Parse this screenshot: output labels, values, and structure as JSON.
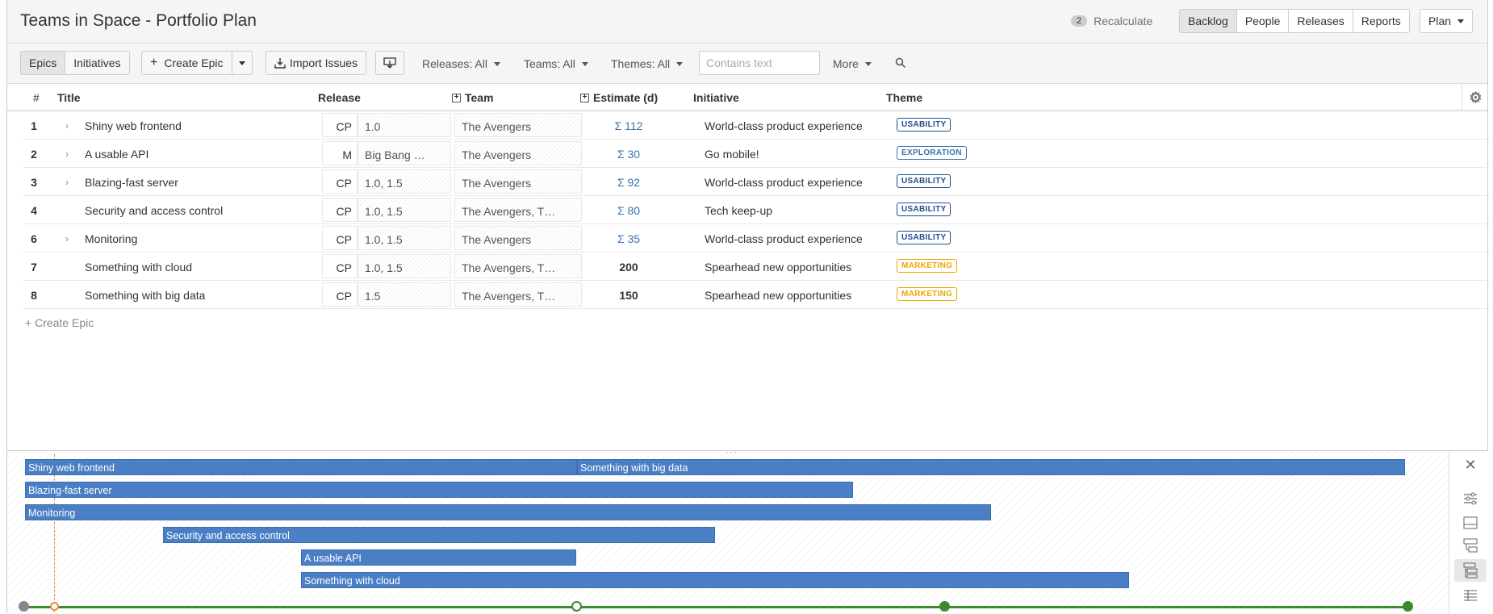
{
  "header": {
    "title": "Teams in Space - Portfolio Plan",
    "recalc_count": "2",
    "recalc_label": "Recalculate",
    "views": [
      "Backlog",
      "People",
      "Releases",
      "Reports"
    ],
    "active_view": "Backlog",
    "plan_label": "Plan"
  },
  "toolbar": {
    "epics_label": "Epics",
    "initiatives_label": "Initiatives",
    "create_epic_label": "Create Epic",
    "import_label": "Import Issues",
    "releases_filter": "Releases: All",
    "teams_filter": "Teams: All",
    "themes_filter": "Themes: All",
    "search_placeholder": "Contains text",
    "more_label": "More"
  },
  "table": {
    "columns": {
      "num": "#",
      "title": "Title",
      "release": "Release",
      "team": "Team",
      "estimate": "Estimate (d)",
      "initiative": "Initiative",
      "theme": "Theme"
    },
    "rows": [
      {
        "num": "1",
        "expandable": true,
        "title": "Shiny web frontend",
        "rel_code": "CP",
        "release": "1.0",
        "team": "The Avengers",
        "estimate": "Σ 112",
        "est_sum": true,
        "initiative": "World-class product experience",
        "theme": "USABILITY"
      },
      {
        "num": "2",
        "expandable": true,
        "title": "A usable API",
        "rel_code": "M",
        "release": "Big Bang …",
        "team": "The Avengers",
        "estimate": "Σ 30",
        "est_sum": true,
        "initiative": "Go mobile!",
        "theme": "EXPLORATION"
      },
      {
        "num": "3",
        "expandable": true,
        "title": "Blazing-fast server",
        "rel_code": "CP",
        "release": "1.0, 1.5",
        "team": "The Avengers",
        "estimate": "Σ 92",
        "est_sum": true,
        "initiative": "World-class product experience",
        "theme": "USABILITY"
      },
      {
        "num": "4",
        "expandable": false,
        "title": "Security and access control",
        "rel_code": "CP",
        "release": "1.0, 1.5",
        "team": "The Avengers, T…",
        "estimate": "Σ 80",
        "est_sum": true,
        "initiative": "Tech keep-up",
        "theme": "USABILITY"
      },
      {
        "num": "6",
        "expandable": true,
        "title": "Monitoring",
        "rel_code": "CP",
        "release": "1.0, 1.5",
        "team": "The Avengers",
        "estimate": "Σ 35",
        "est_sum": true,
        "initiative": "World-class product experience",
        "theme": "USABILITY"
      },
      {
        "num": "7",
        "expandable": false,
        "title": "Something with cloud",
        "rel_code": "CP",
        "release": "1.0, 1.5",
        "team": "The Avengers, T…",
        "estimate": "200",
        "est_sum": false,
        "initiative": "Spearhead new opportunities",
        "theme": "MARKETING"
      },
      {
        "num": "8",
        "expandable": false,
        "title": "Something with big data",
        "rel_code": "CP",
        "release": "1.5",
        "team": "The Avengers, T…",
        "estimate": "150",
        "est_sum": false,
        "initiative": "Spearhead new opportunities",
        "theme": "MARKETING"
      }
    ],
    "create_epic_link": "+ Create Epic"
  },
  "theme_colors": {
    "USABILITY": "#1f4e8c",
    "EXPLORATION": "#3b73af",
    "MARKETING": "#f0a500"
  },
  "timeline": {
    "bars": [
      {
        "label": "Shiny web frontend"
      },
      {
        "label": "Something with big data"
      },
      {
        "label": "Blazing-fast server"
      },
      {
        "label": "Monitoring"
      },
      {
        "label": "Security and access control"
      },
      {
        "label": "A usable API"
      },
      {
        "label": "Something with cloud"
      }
    ],
    "bar_color": "#4a7ec5",
    "release_track_color": "#3d8a2e",
    "today_color": "#f08a3c"
  }
}
